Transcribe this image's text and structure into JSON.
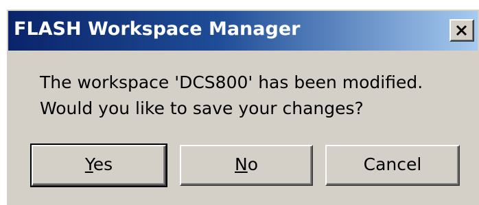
{
  "window": {
    "title": "FLASH Workspace Manager",
    "close_icon": "close-x-icon"
  },
  "message": {
    "line1": "The workspace 'DCS800' has been modified.",
    "line2": "Would you like to save your changes?"
  },
  "buttons": {
    "yes": {
      "accel": "Y",
      "rest": "es"
    },
    "no": {
      "accel": "N",
      "rest": "o"
    },
    "cancel": {
      "label": "Cancel"
    }
  },
  "colors": {
    "titlebar_start": "#0a246a",
    "titlebar_end": "#a6caf0",
    "dialog_face": "#d4d0c8"
  }
}
